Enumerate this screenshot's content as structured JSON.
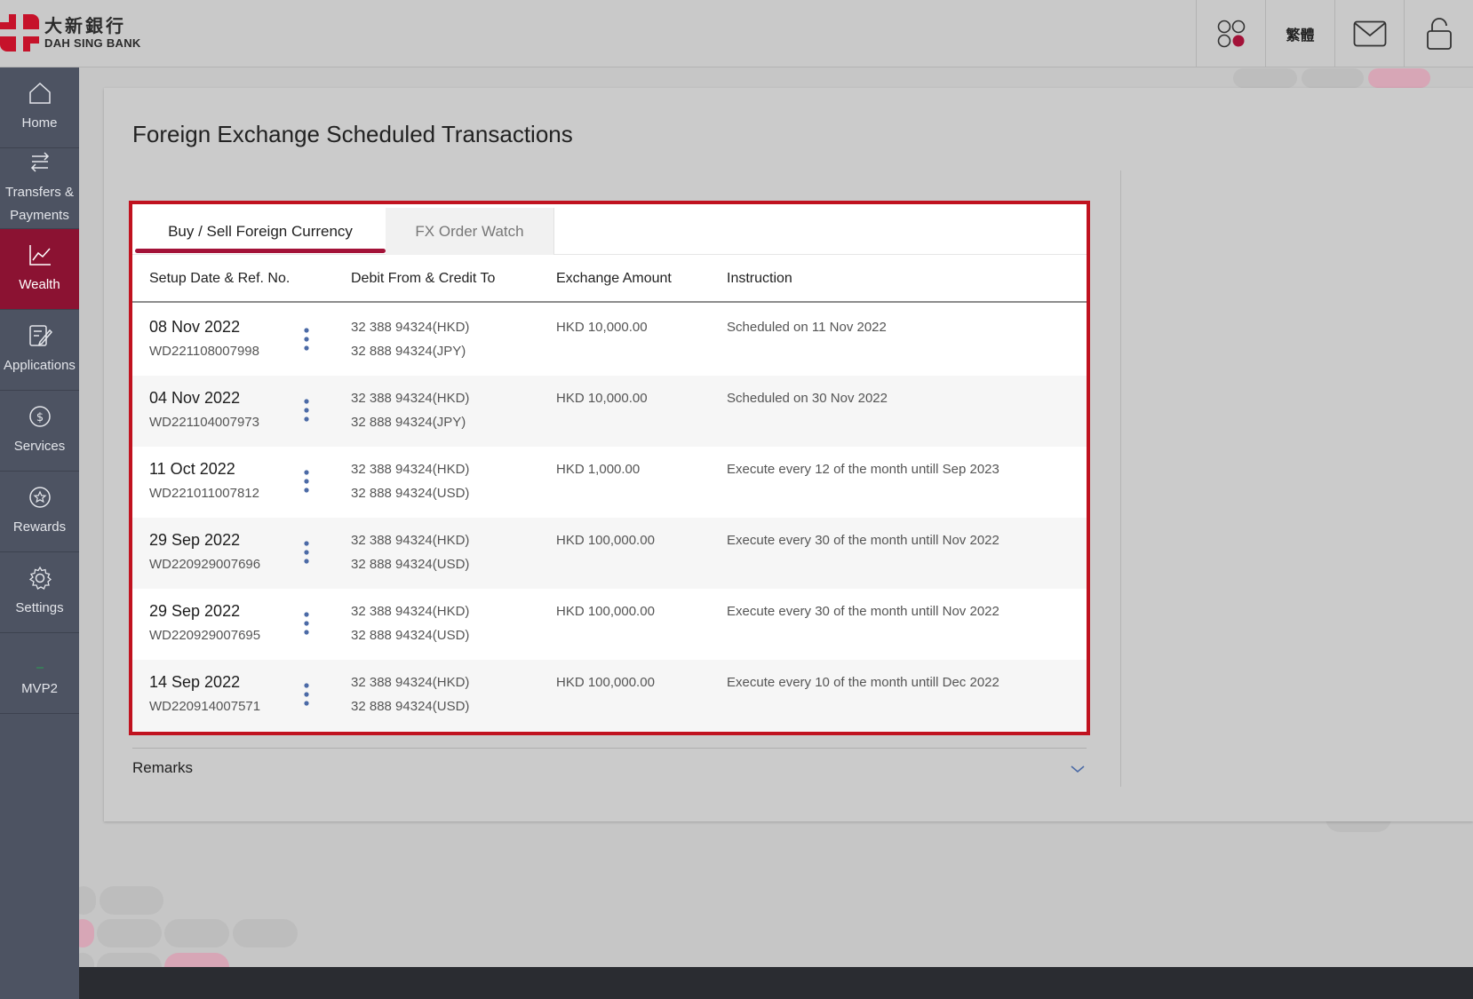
{
  "header": {
    "logo_cn": "大新銀行",
    "logo_en": "DAH SING BANK",
    "language_toggle": "繁體"
  },
  "sidebar": {
    "items": [
      {
        "label": "Home"
      },
      {
        "label_line1": "Transfers &",
        "label_line2": "Payments"
      },
      {
        "label": "Wealth"
      },
      {
        "label": "Applications"
      },
      {
        "label": "Services"
      },
      {
        "label": "Rewards"
      },
      {
        "label": "Settings"
      },
      {
        "label": "MVP2"
      }
    ]
  },
  "page": {
    "title": "Foreign Exchange Scheduled Transactions",
    "tabs": [
      "Buy / Sell Foreign Currency",
      "FX Order Watch"
    ],
    "columns": [
      "Setup Date & Ref. No.",
      "Debit From & Credit To",
      "Exchange Amount",
      "Instruction"
    ],
    "rows": [
      {
        "date": "08 Nov 2022",
        "ref": "WD221108007998",
        "debit": "32 388 94324(HKD)",
        "credit": "32 888 94324(JPY)",
        "amount": "HKD 10,000.00",
        "instruction": "Scheduled on 11 Nov 2022"
      },
      {
        "date": "04 Nov 2022",
        "ref": "WD221104007973",
        "debit": "32 388 94324(HKD)",
        "credit": "32 888 94324(JPY)",
        "amount": "HKD 10,000.00",
        "instruction": "Scheduled on 30 Nov 2022"
      },
      {
        "date": "11 Oct 2022",
        "ref": "WD221011007812",
        "debit": "32 388 94324(HKD)",
        "credit": "32 888 94324(USD)",
        "amount": "HKD 1,000.00",
        "instruction": "Execute every 12 of the month untill Sep 2023"
      },
      {
        "date": "29 Sep 2022",
        "ref": "WD220929007696",
        "debit": "32 388 94324(HKD)",
        "credit": "32 888 94324(USD)",
        "amount": "HKD 100,000.00",
        "instruction": "Execute every 30 of the month untill Nov 2022"
      },
      {
        "date": "29 Sep 2022",
        "ref": "WD220929007695",
        "debit": "32 388 94324(HKD)",
        "credit": "32 888 94324(USD)",
        "amount": "HKD 100,000.00",
        "instruction": "Execute every 30 of the month untill Nov 2022"
      },
      {
        "date": "14 Sep 2022",
        "ref": "WD220914007571",
        "debit": "32 388 94324(HKD)",
        "credit": "32 888 94324(USD)",
        "amount": "HKD 100,000.00",
        "instruction": "Execute every 10 of the month untill Dec 2022"
      }
    ],
    "remarks_label": "Remarks"
  },
  "colors": {
    "brand": "#c0121f",
    "active_nav": "#8b1232",
    "sidebar_bg": "#4d5362"
  }
}
